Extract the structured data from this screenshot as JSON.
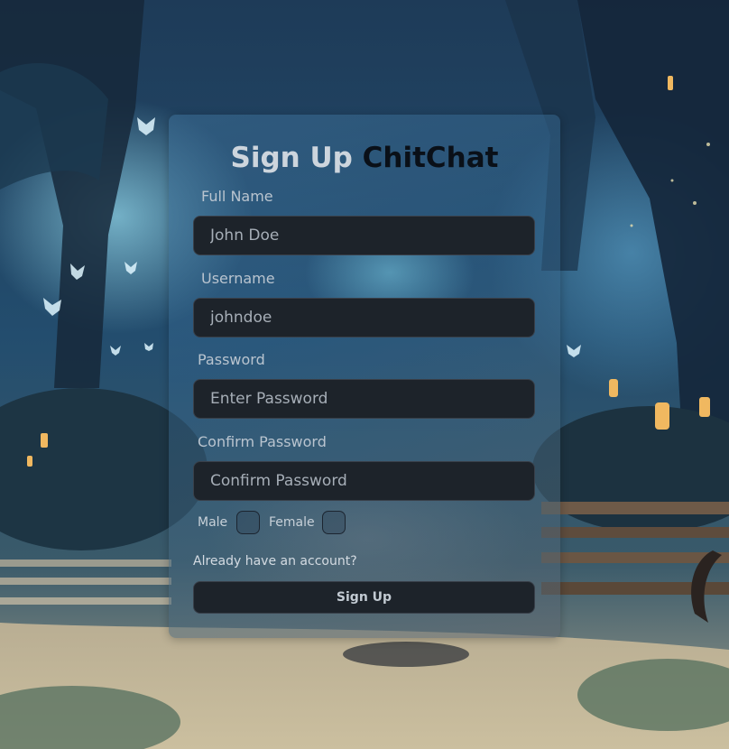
{
  "form": {
    "title_part1": "Sign Up",
    "title_part2": "ChitChat",
    "full_name": {
      "label": "Full Name",
      "placeholder": "John Doe",
      "value": ""
    },
    "username": {
      "label": "Username",
      "placeholder": "johndoe",
      "value": ""
    },
    "password": {
      "label": "Password",
      "placeholder": "Enter Password",
      "value": ""
    },
    "confirm_password": {
      "label": "Confirm Password",
      "placeholder": "Confirm Password",
      "value": ""
    },
    "gender": {
      "male_label": "Male",
      "female_label": "Female",
      "male_checked": false,
      "female_checked": false
    },
    "login_link": "Already have an account?",
    "submit_label": "Sign Up"
  },
  "colors": {
    "input_bg": "#1d232a",
    "title_light": "#cdd5dd",
    "title_dark": "#0a1018",
    "label": "#b9c4cf"
  }
}
